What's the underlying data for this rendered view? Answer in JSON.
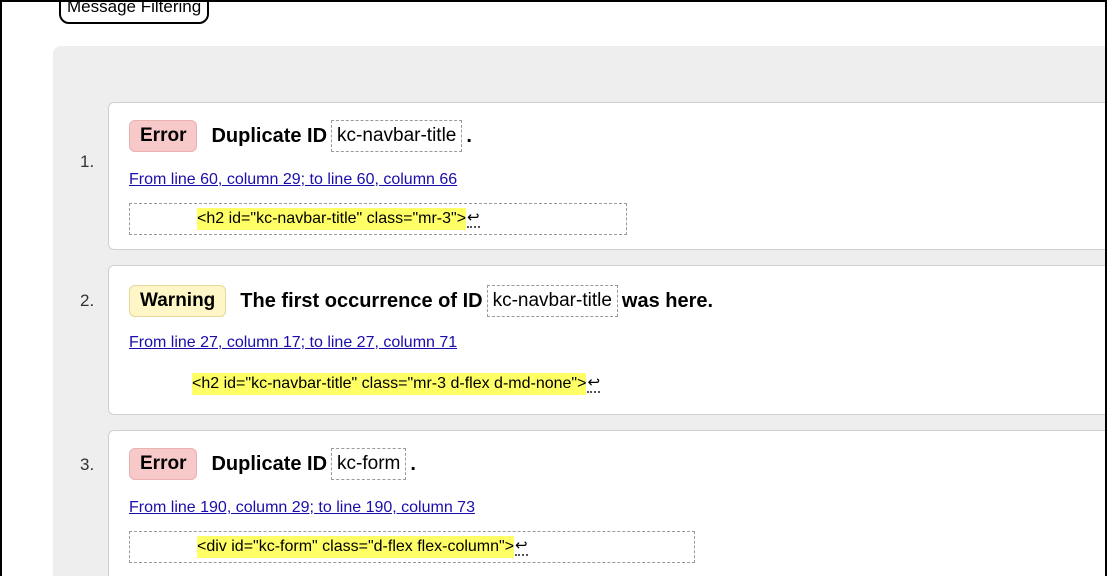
{
  "filter": {
    "label": "Message Filtering"
  },
  "messages": [
    {
      "number": "1.",
      "type": "Error",
      "lead": "Duplicate ID",
      "id": "kc-navbar-title",
      "tail": ".",
      "location": "From line 60, column 29; to line 60, column 66",
      "extract": "<h2 id=\"kc-navbar-title\" class=\"mr-3\">",
      "linefeed": "↩"
    },
    {
      "number": "2.",
      "type": "Warning",
      "lead": "The first occurrence of ID",
      "id": "kc-navbar-title",
      "tail": "was here.",
      "location": "From line 27, column 17; to line 27, column 71",
      "extract": "<h2 id=\"kc-navbar-title\" class=\"mr-3 d-flex d-md-none\">",
      "linefeed": "↩"
    },
    {
      "number": "3.",
      "type": "Error",
      "lead": "Duplicate ID",
      "id": "kc-form",
      "tail": ".",
      "location": "From line 190, column 29; to line 190, column 73",
      "extract": "<div id=\"kc-form\" class=\"d-flex flex-column\">",
      "linefeed": "↩"
    }
  ],
  "colors": {
    "error_badge": "#f8c9c9",
    "warning_badge": "#fff6c7",
    "highlight": "#ffff66",
    "link": "#1a0dab",
    "panel": "#eeeeee"
  }
}
